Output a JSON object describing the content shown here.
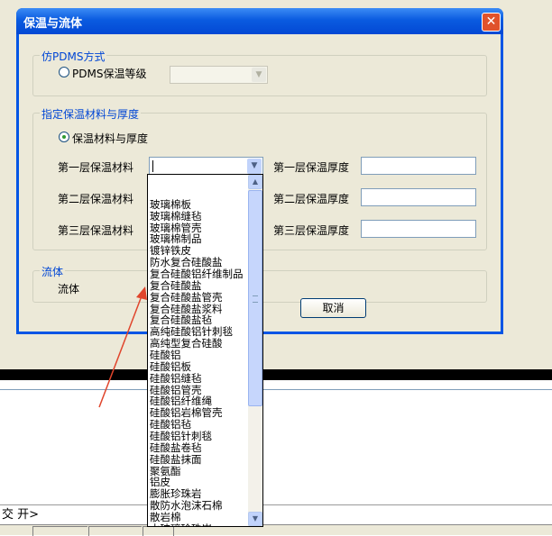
{
  "dialog": {
    "title": "保温与流体",
    "close_glyph": "✕",
    "group_pdms": {
      "label": "仿PDMS方式",
      "radio_label": "PDMS保温等级",
      "combo_value": ""
    },
    "group_material": {
      "label": "指定保温材料与厚度",
      "radio_label": "保温材料与厚度",
      "layer1_label": "第一层保温材料",
      "layer2_label": "第二层保温材料",
      "layer3_label": "第三层保温材料",
      "thickness1_label": "第一层保温厚度",
      "thickness2_label": "第二层保温厚度",
      "thickness3_label": "第三层保温厚度",
      "layer1_value": "",
      "thickness1_value": "",
      "thickness2_value": "",
      "thickness3_value": ""
    },
    "group_fluid": {
      "label": "流体",
      "field_label": "流体"
    },
    "cancel_label": "取消"
  },
  "dropdown": {
    "items": [
      "",
      "玻璃棉板",
      "玻璃棉缝毡",
      "玻璃棉管壳",
      "玻璃棉制品",
      "镀锌铁皮",
      "防水复合硅酸盐",
      "复合硅酸铝纤维制品",
      "复合硅酸盐",
      "复合硅酸盐管壳",
      "复合硅酸盐浆料",
      "复合硅酸盐毡",
      "高纯硅酸铝针刺毯",
      "高纯型复合硅酸",
      "硅酸铝",
      "硅酸铝板",
      "硅酸铝缝毡",
      "硅酸铝管壳",
      "硅酸铝纤维绳",
      "硅酸铝岩棉管壳",
      "硅酸铝毡",
      "硅酸铝针刺毯",
      "硅酸盐卷毡",
      "硅酸盐抹面",
      "聚氨酯",
      "铝皮",
      "膨胀珍珠岩",
      "散防水泡沫石棉",
      "散岩棉",
      "水玻璃珍珠岩"
    ]
  },
  "command_line": {
    "text": "交  开>"
  },
  "colors": {
    "titlebar": "#0a5be0",
    "group_label": "#0046d5",
    "annotation_arrow": "#e0452c"
  }
}
